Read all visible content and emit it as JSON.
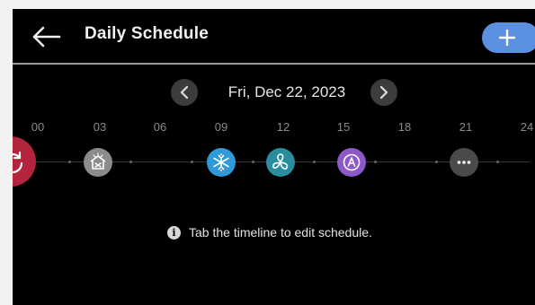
{
  "header": {
    "title": "Daily Schedule",
    "add_icon": "plus-icon",
    "back_icon": "arrow-left-icon"
  },
  "date_nav": {
    "date": "Fri, Dec 22, 2023",
    "prev_icon": "chevron-left-icon",
    "next_icon": "chevron-right-icon"
  },
  "timeline": {
    "ticks": [
      "00",
      "03",
      "06",
      "09",
      "12",
      "15",
      "18",
      "21",
      "24"
    ],
    "events": [
      {
        "name": "dehumidify-mode-icon",
        "color": "#8c8c8c"
      },
      {
        "name": "cool-mode-icon",
        "color": "#2e9ad8"
      },
      {
        "name": "fan-mode-icon",
        "color": "#2a8d9e"
      },
      {
        "name": "auto-mode-icon",
        "color": "#8e58c8"
      },
      {
        "name": "more-icon",
        "color": "#4a4a4a"
      }
    ],
    "refresh_icon": "refresh-icon",
    "refresh_color": "#b3243d"
  },
  "hint": {
    "icon": "info-icon",
    "text": "Tab the timeline to edit schedule."
  }
}
